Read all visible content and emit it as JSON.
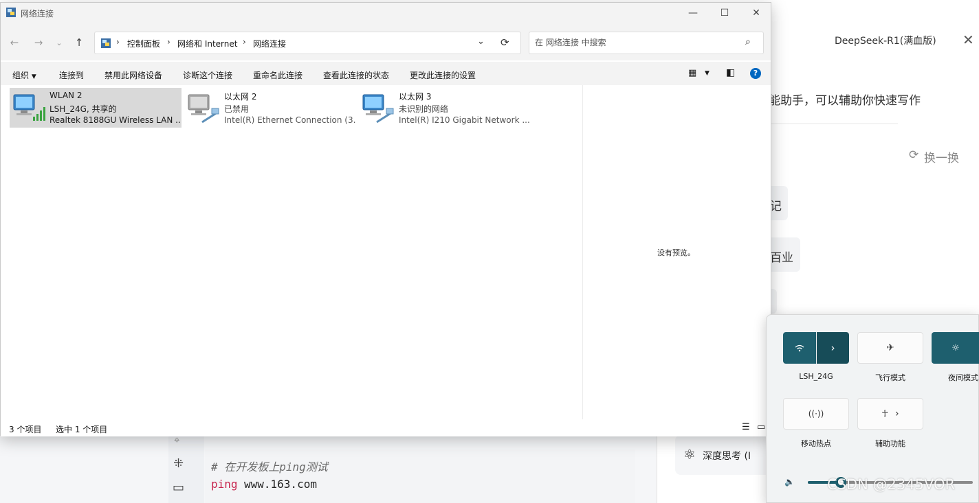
{
  "background": {
    "right_panel": {
      "model_label": "DeepSeek-R1(满血版)",
      "intro_text": "能助手，可以辅助你快速写作",
      "refresh_label": "换一换",
      "chip_1": "记",
      "chip_2": "百业",
      "deep_think_label": "深度思考 (I"
    },
    "code": {
      "comment": "# 在开发板上ping测试",
      "keyword": "ping",
      "argument": "www.163.com"
    },
    "watermark": "CSDN @2345VOR"
  },
  "window": {
    "title": "网络连接",
    "address": {
      "crumbs": [
        "控制面板",
        "网络和 Internet",
        "网络连接"
      ]
    },
    "search": {
      "placeholder": "在 网络连接 中搜索"
    },
    "commands": [
      "组织",
      "连接到",
      "禁用此网络设备",
      "诊断这个连接",
      "重命名此连接",
      "查看此连接的状态",
      "更改此连接的设置"
    ],
    "connections": [
      {
        "name": "WLAN 2",
        "status": "LSH_24G, 共享的",
        "device": "Realtek 8188GU Wireless LAN ...",
        "selected": true
      },
      {
        "name": "以太网 2",
        "status": "已禁用",
        "device": "Intel(R) Ethernet Connection (3...",
        "selected": false
      },
      {
        "name": "以太网 3",
        "status": "未识别的网络",
        "device": "Intel(R) I210 Gigabit Network ...",
        "selected": false
      }
    ],
    "preview_text": "没有预览。",
    "status": {
      "item_count": "3 个项目",
      "selected_count": "选中 1 个项目"
    }
  },
  "quick_settings": {
    "tiles": [
      {
        "label": "LSH_24G",
        "icon": "wifi-icon",
        "active": true
      },
      {
        "label": "飞行模式",
        "icon": "airplane-icon",
        "active": false
      },
      {
        "label": "夜间模式",
        "icon": "night-light-icon",
        "active": true
      },
      {
        "label": "移动热点",
        "icon": "hotspot-icon",
        "active": false
      },
      {
        "label": "辅助功能",
        "icon": "accessibility-icon",
        "active": false
      }
    ],
    "volume_level": 0.2
  },
  "colors": {
    "accent": "#1e5f6e",
    "selection": "#d9d9d9",
    "help_blue": "#0067c0"
  }
}
